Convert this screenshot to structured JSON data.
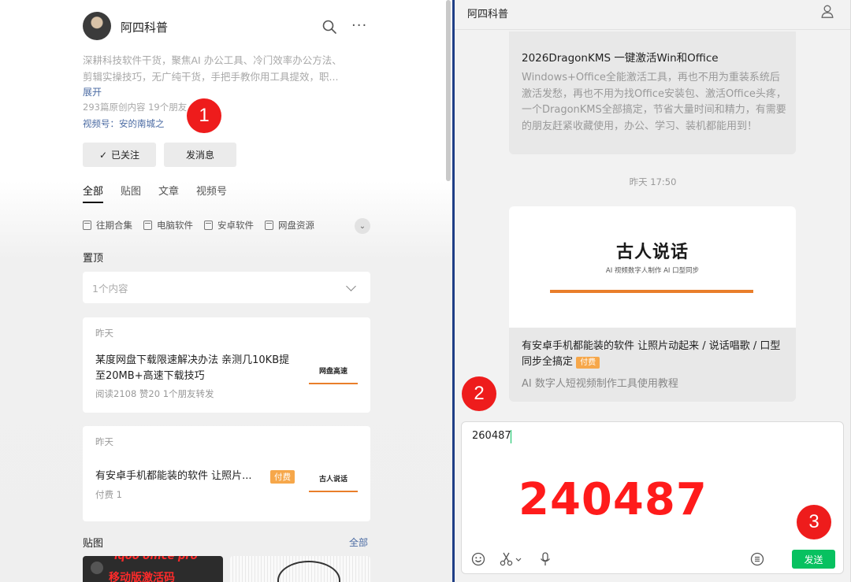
{
  "left": {
    "account_name": "阿四科普",
    "description_line1": "深耕科技软件干货，聚焦AI 办公工具、冷门效率办公方法、",
    "description_line2": "剪辑实操技巧，无广纯干货，手把手教你用工具提效，职...",
    "expand_label": "展开",
    "stats": "293篇原创内容  19个朋友",
    "channel": "视频号：安的南城之",
    "follow_button": "已关注",
    "message_button": "发消息",
    "tabs": [
      {
        "label": "全部",
        "active": true
      },
      {
        "label": "贴图"
      },
      {
        "label": "文章"
      },
      {
        "label": "视频号"
      }
    ],
    "categories": [
      "往期合集",
      "电脑软件",
      "安卓软件",
      "网盘资源"
    ],
    "pinned_title": "置顶",
    "pinned_select": "1个内容",
    "articles": [
      {
        "date": "昨天",
        "title": "某度网盘下载限速解决办法 亲测几10KB提至20MB+高速下载技巧",
        "meta": "阅读2108  赞20  1个朋友转发",
        "thumb_title": "网盘高速"
      },
      {
        "date": "昨天",
        "title": "有安卓手机都能装的软件 让照片...",
        "badge": "付费",
        "meta": "付费 1",
        "thumb_title": "古人说话"
      }
    ],
    "posts_title": "贴图",
    "posts_all": "全部",
    "photo1_text_top": "iqoo office pro",
    "photo1_text_bottom": "移动版激活码"
  },
  "right": {
    "chat_title": "阿四科普",
    "message1": {
      "title": "2026DragonKMS 一键激活Win和Office",
      "desc": "Windows+Office全能激活工具，再也不用为重装系统后激活发愁，再也不用为找Office安装包、激活Office头疼，一个DragonKMS全部搞定，节省大量时间和精力，有需要的朋友赶紧收藏使用，办公、学习、装机都能用到！"
    },
    "timestamp": "昨天 17:50",
    "message2": {
      "cover_title": "古人说话",
      "cover_subtitle": "AI 视频数字人制作 AI 口型同步",
      "title": "有安卓手机都能装的软件 让照片动起来 / 说话唱歌 / 口型同步全搞定",
      "badge": "付费",
      "desc": "AI 数字人短视频制作工具使用教程"
    },
    "input_value": "260487",
    "big_code": "240487",
    "send_button": "发送"
  },
  "markers": [
    "1",
    "2",
    "3"
  ],
  "colors": {
    "accent_green": "#07c160",
    "marker_red": "#ee1c1c",
    "code_red": "#ff1b1b",
    "paid_orange": "#f6a74a",
    "link_blue": "#4b6ba3"
  }
}
